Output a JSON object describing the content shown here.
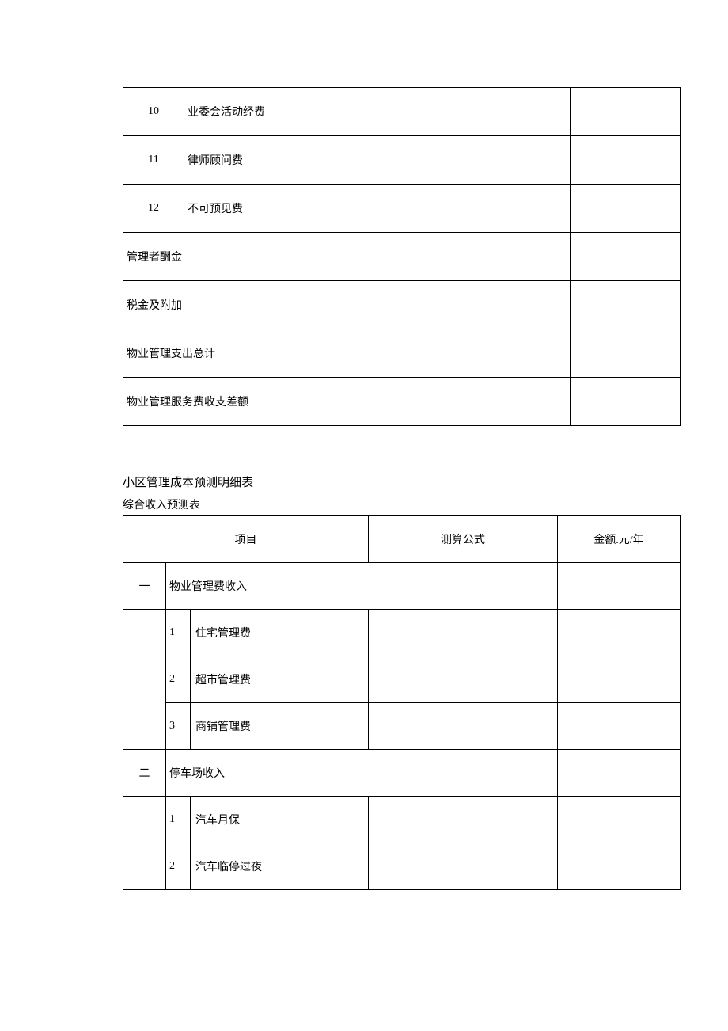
{
  "table1": {
    "rows": [
      {
        "num": "10",
        "desc": "业委会活动经费"
      },
      {
        "num": "11",
        "desc": "律师顾问费"
      },
      {
        "num": "12",
        "desc": "不可预见费"
      }
    ],
    "wide_rows": [
      "管理者酬金",
      "税金及附加",
      "物业管理支出总计",
      "物业管理服务费收支差额"
    ]
  },
  "section": {
    "title": "小区管理成本预测明细表",
    "subtitle": "综合收入预测表"
  },
  "table2": {
    "headers": {
      "project": "项目",
      "formula": "测算公式",
      "amount": "金额.元/年"
    },
    "groups": [
      {
        "num": "一",
        "label": "物业管理费收入",
        "items": [
          {
            "n": "1",
            "label": "住宅管理费"
          },
          {
            "n": "2",
            "label": "超市管理费"
          },
          {
            "n": "3",
            "label": "商铺管理费"
          }
        ]
      },
      {
        "num": "二",
        "label": "停车场收入",
        "items": [
          {
            "n": "1",
            "label": "汽车月保"
          },
          {
            "n": "2",
            "label": "汽车临停过夜"
          }
        ]
      }
    ]
  }
}
